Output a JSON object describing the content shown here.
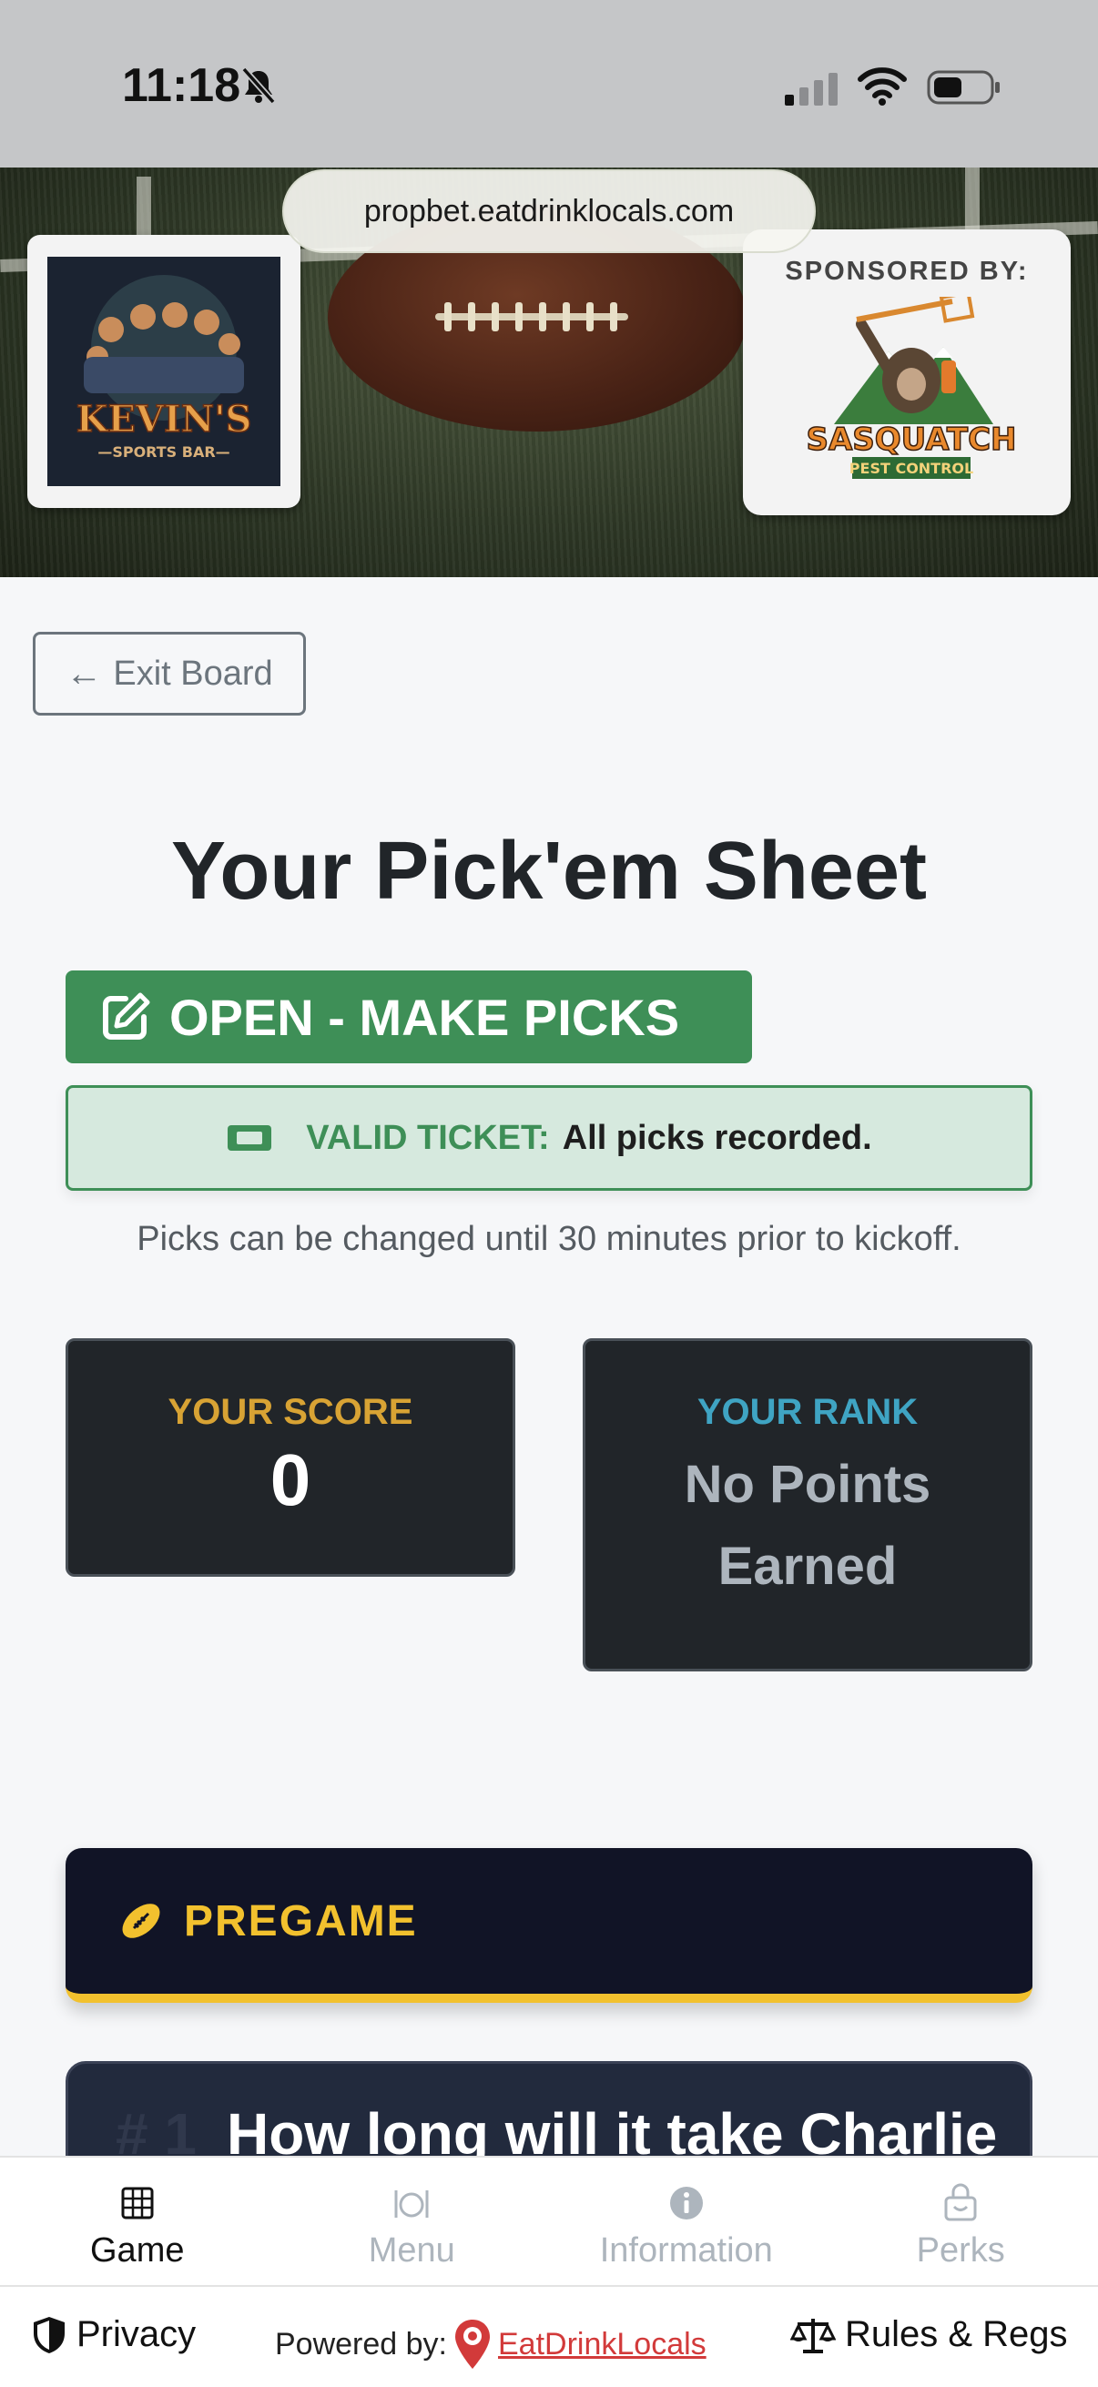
{
  "status_bar": {
    "time": "11:18"
  },
  "browser": {
    "url": "propbet.eatdrinklocals.com"
  },
  "hero": {
    "venue_logo_text": "KEVIN'S",
    "venue_logo_subtext": "SPORTS BAR",
    "sponsor_label": "SPONSORED BY:",
    "sponsor_name": "SASQUATCH",
    "sponsor_subname": "PEST CONTROL"
  },
  "exit_button": {
    "label": "Exit Board",
    "icon": "arrow-left-icon"
  },
  "page_title": "Your Pick'em Sheet",
  "status_pill": {
    "label": "OPEN - MAKE PICKS",
    "icon": "edit-icon",
    "color": "#3e8f57"
  },
  "ticket": {
    "label": "VALID TICKET:",
    "message": "All picks recorded.",
    "icon": "ticket-icon"
  },
  "note": "Picks can be changed until 30 minutes prior to kickoff.",
  "score": {
    "label": "YOUR SCORE",
    "value": "0",
    "color": "#d8a334"
  },
  "rank": {
    "label": "YOUR RANK",
    "value_line1": "No Points",
    "value_line2": "Earned",
    "color": "#3fa4c3"
  },
  "section": {
    "title": "PREGAME",
    "icon": "football-icon",
    "accent": "#f2c12e"
  },
  "question": {
    "number": "# 1",
    "text": "How long will it take Charlie"
  },
  "bottom_nav": [
    {
      "label": "Game",
      "icon": "grid-icon",
      "active": true
    },
    {
      "label": "Menu",
      "icon": "utensils-icon",
      "active": false
    },
    {
      "label": "Information",
      "icon": "info-icon",
      "active": false
    },
    {
      "label": "Perks",
      "icon": "gift-bag-icon",
      "active": false
    }
  ],
  "footer": {
    "privacy": "Privacy",
    "powered_by": "Powered by:",
    "powered_link": "EatDrinkLocals",
    "rules": "Rules & Regs"
  }
}
